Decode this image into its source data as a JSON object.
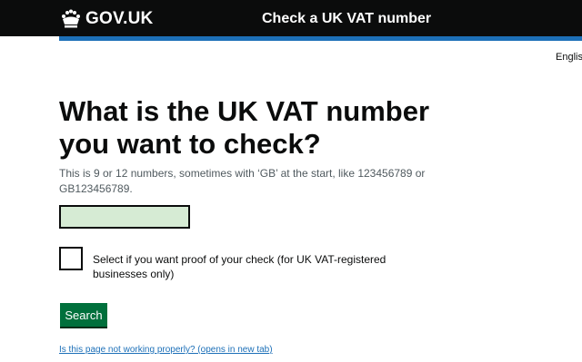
{
  "header": {
    "logo_text": "GOV.UK",
    "service_name": "Check a UK VAT number",
    "language": "English"
  },
  "main": {
    "title": "What is the UK VAT number you want to check?",
    "hint": "This is 9 or 12 numbers, sometimes with ‘GB’ at the start, like 123456789 or GB123456789.",
    "vat_input": {
      "value": "",
      "placeholder": ""
    },
    "proof_checkbox": {
      "label": "Select if you want proof of your check (for UK VAT-registered businesses only)",
      "checked": false
    },
    "search_button": "Search",
    "problem_link": "Is this page not working properly? (opens in new tab)"
  },
  "colors": {
    "header_bg": "#0b0c0c",
    "header_stripe": "#1d70b8",
    "input_fill": "#d6ebd4",
    "button_green": "#00703c",
    "link_blue": "#1d70b8",
    "hint_grey": "#505a5f"
  }
}
